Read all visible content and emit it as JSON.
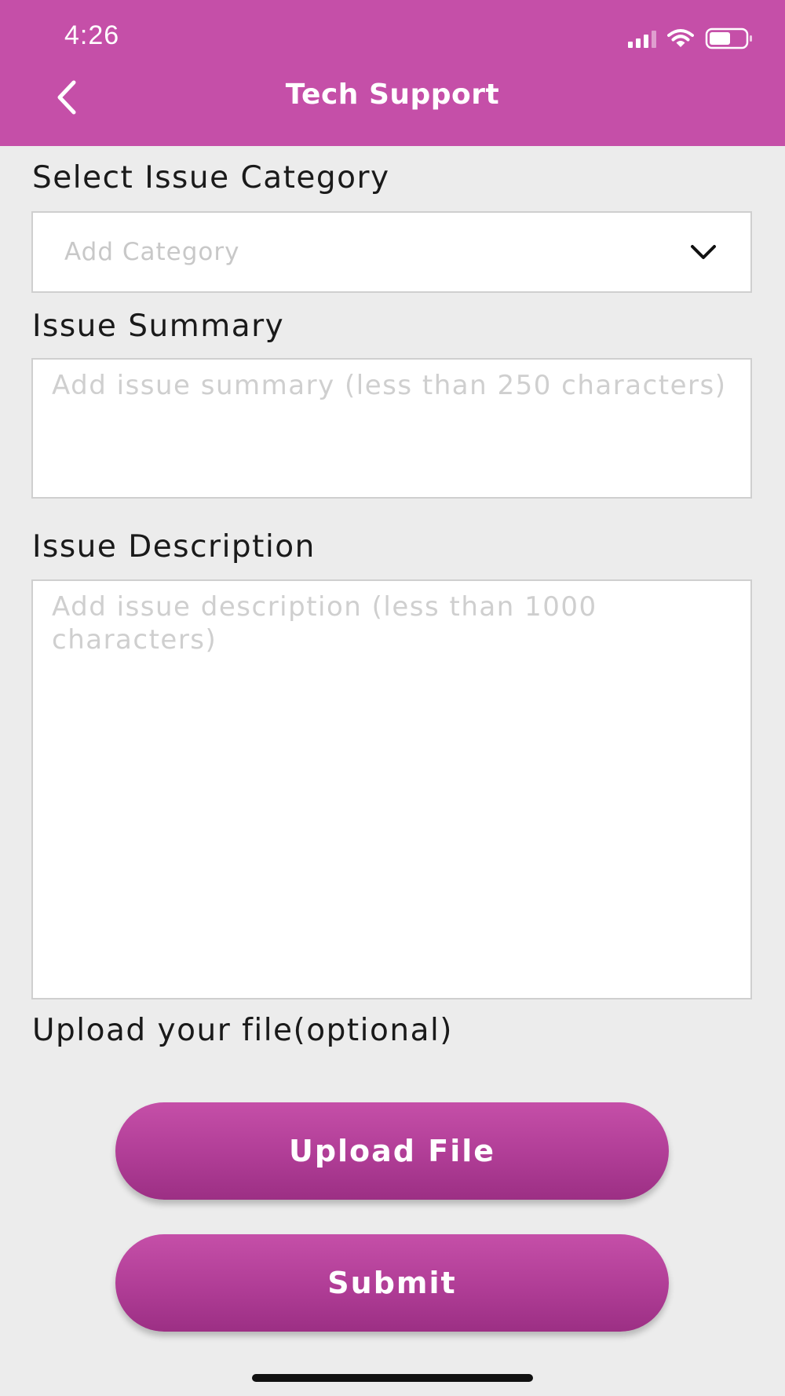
{
  "status_bar": {
    "time": "4:26"
  },
  "header": {
    "title": "Tech Support"
  },
  "form": {
    "category": {
      "label": "Select Issue Category",
      "placeholder": "Add Category",
      "value": ""
    },
    "summary": {
      "label": "Issue Summary",
      "placeholder": "Add issue summary (less than 250 characters)",
      "value": ""
    },
    "description": {
      "label": "Issue Description",
      "placeholder": "Add issue description (less than 1000 characters)",
      "value": ""
    },
    "upload": {
      "label": "Upload your file(optional)"
    }
  },
  "buttons": {
    "upload_label": "Upload File",
    "submit_label": "Submit"
  },
  "icons": {
    "back": "chevron-left-icon",
    "dropdown": "chevron-down-icon",
    "signal": "cellular-signal-icon",
    "wifi": "wifi-icon",
    "battery": "battery-icon"
  },
  "colors": {
    "brand": "#c54fa8",
    "button_bottom": "#9c2f84",
    "background": "#ececec",
    "placeholder": "#cfcfcf"
  }
}
